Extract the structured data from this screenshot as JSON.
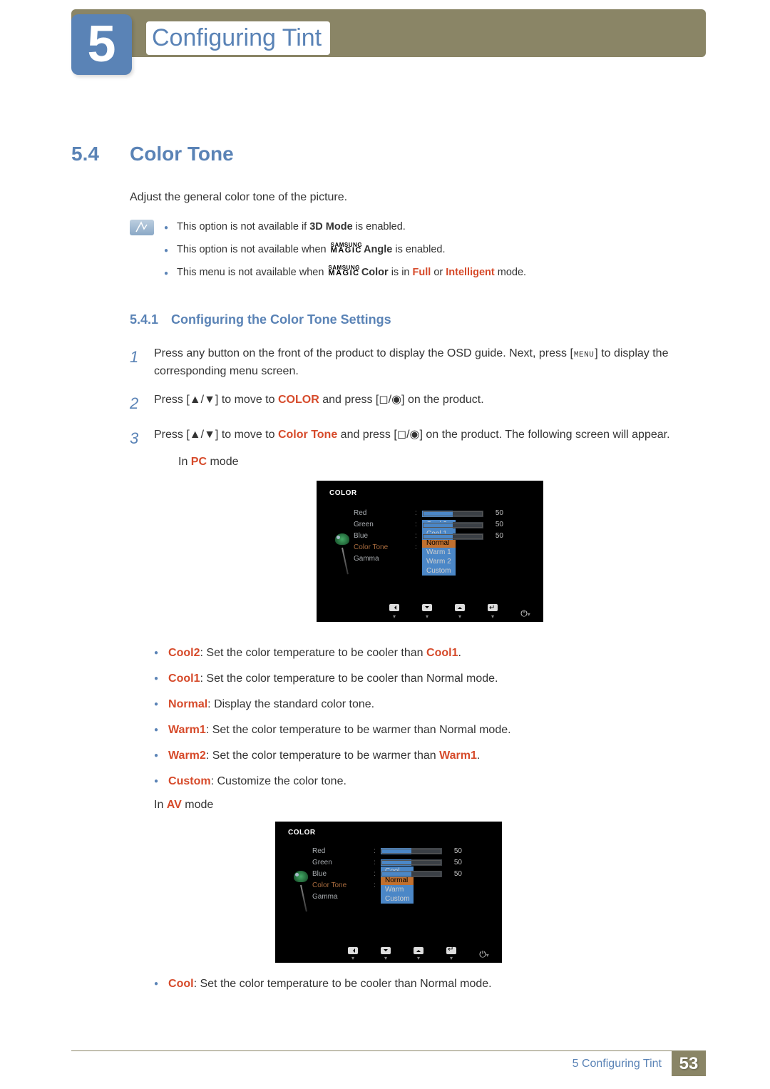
{
  "chapter": {
    "num": "5",
    "title": "Configuring Tint"
  },
  "section": {
    "num": "5.4",
    "title": "Color Tone",
    "intro": "Adjust the general color tone of the picture."
  },
  "notes": {
    "n1_a": "This option is not available if ",
    "n1_b": "3D Mode",
    "n1_c": " is enabled.",
    "n2_a": "This option is not available when ",
    "n2_b": "Angle",
    "n2_c": " is enabled.",
    "n3_a": "This menu is not available when ",
    "n3_b": "Color",
    "n3_c": " is in ",
    "n3_d": "Full",
    "n3_e": " or ",
    "n3_f": "Intelligent",
    "n3_g": " mode."
  },
  "subsection": {
    "num": "5.4.1",
    "title": "Configuring the Color Tone Settings"
  },
  "steps": {
    "s1": "Press any button on the front of the product to display the OSD guide. Next, press [",
    "s1b": "] to display the corresponding menu screen.",
    "menu_key": "MENU",
    "s2a": "Press [",
    "s2b": "] to move to ",
    "s2c": "COLOR",
    "s2d": " and press [",
    "s2e": "] on the product.",
    "s3a": "Press [",
    "s3b": "] to move to ",
    "s3c": "Color Tone",
    "s3d": " and press [",
    "s3e": "] on the product. The following screen will appear.",
    "pc_mode_a": "In ",
    "pc_mode_b": "PC",
    "pc_mode_c": " mode",
    "av_mode_a": "In ",
    "av_mode_b": "AV",
    "av_mode_c": " mode"
  },
  "osd": {
    "title": "COLOR",
    "rows": {
      "red": {
        "label": "Red",
        "value": "50"
      },
      "green": {
        "label": "Green",
        "value": "50"
      },
      "blue": {
        "label": "Blue",
        "value": "50"
      },
      "colortone": {
        "label": "Color Tone"
      },
      "gamma": {
        "label": "Gamma"
      }
    },
    "pc_options": [
      "Cool 2",
      "Cool 1",
      "Normal",
      "Warm 1",
      "Warm 2",
      "Custom"
    ],
    "pc_selected": "Normal",
    "av_options": [
      "Cool",
      "Normal",
      "Warm",
      "Custom"
    ],
    "av_selected": "Normal"
  },
  "defs": {
    "cool2_k": "Cool2",
    "cool2_t": ": Set the color temperature to be cooler than ",
    "cool2_k2": "Cool1",
    "cool2_end": ".",
    "cool1_k": "Cool1",
    "cool1_t": ": Set the color temperature to be cooler than Normal mode.",
    "normal_k": "Normal",
    "normal_t": ": Display the standard color tone.",
    "warm1_k": "Warm1",
    "warm1_t": ": Set the color temperature to be warmer than Normal mode.",
    "warm2_k": "Warm2",
    "warm2_t": ": Set the color temperature to be warmer than ",
    "warm2_k2": "Warm1",
    "warm2_end": ".",
    "custom_k": "Custom",
    "custom_t": ": Customize the color tone.",
    "cool_k": "Cool",
    "cool_t": ": Set the color temperature to be cooler than Normal mode."
  },
  "magic": {
    "top": "SAMSUNG",
    "bot": "MAGIC"
  },
  "footer": {
    "label": "5 Configuring Tint",
    "page": "53"
  }
}
